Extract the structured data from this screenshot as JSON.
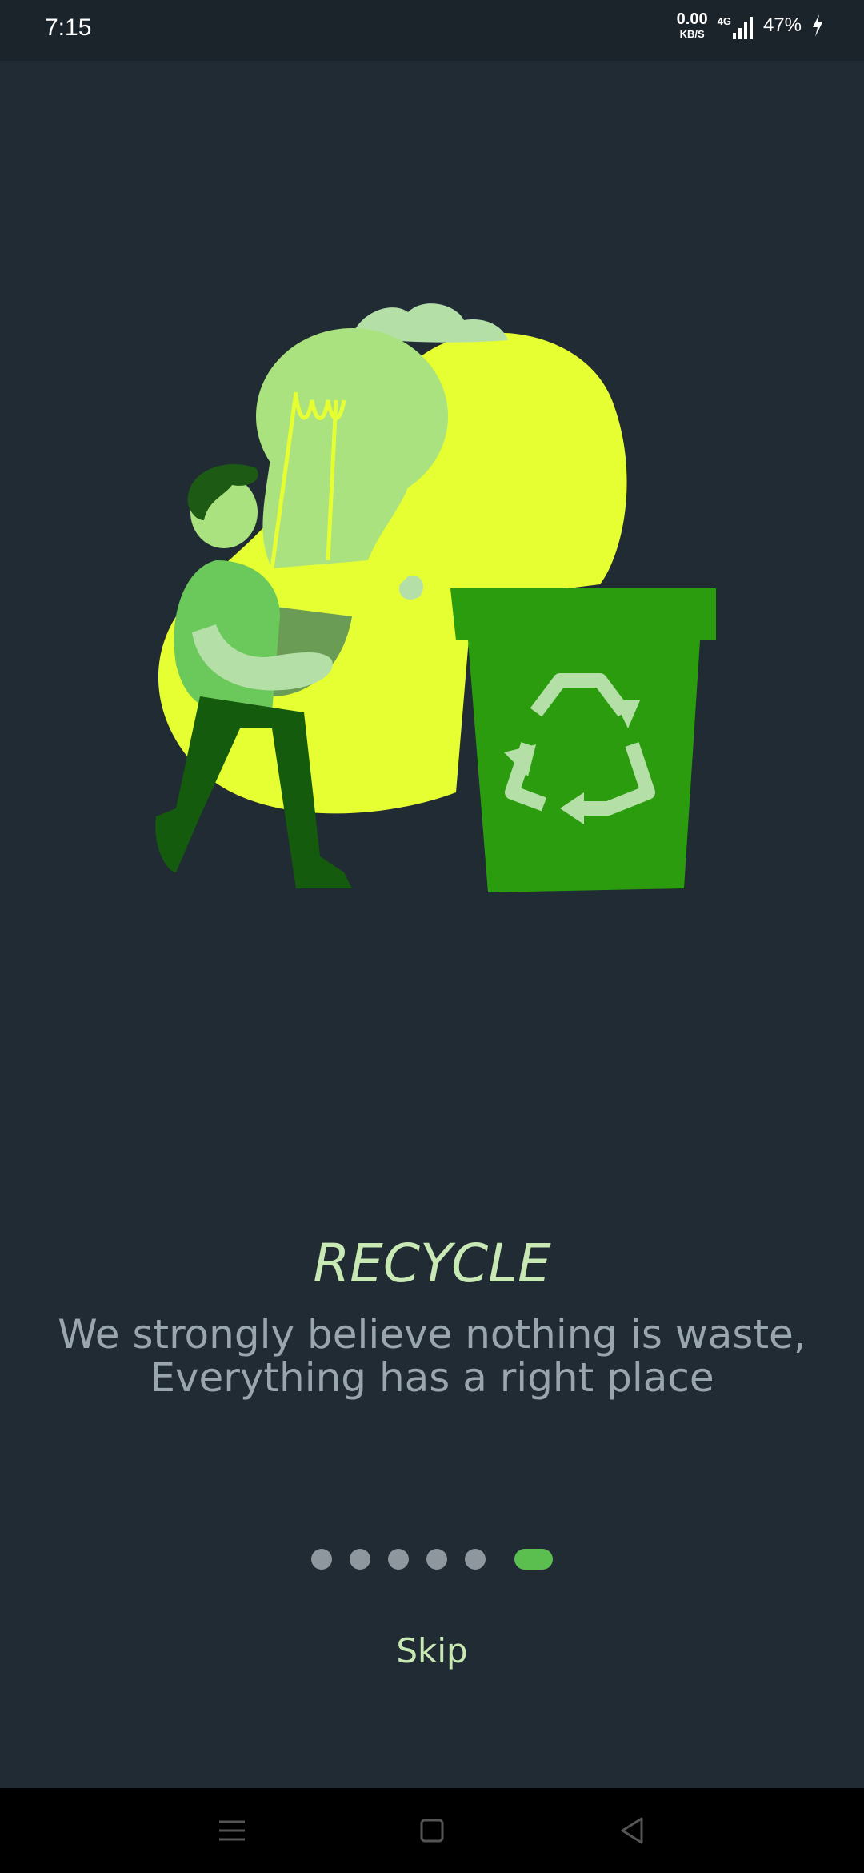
{
  "status_bar": {
    "time": "7:15",
    "net_speed_value": "0.00",
    "net_speed_unit": "KB/S",
    "network_type": "4G",
    "battery": "47%",
    "icons": [
      "signal-icon",
      "battery-charging-icon"
    ]
  },
  "onboarding": {
    "illustration": "recycle-illustration",
    "title": "RECYCLE",
    "subtitle_line1": "We strongly believe nothing is waste,",
    "subtitle_line2": "Everything has a right place",
    "page_count": 6,
    "active_page": 6,
    "skip_label": "Skip"
  },
  "colors": {
    "background": "#212b34",
    "accent": "#5bbf4f",
    "title": "#c8e8b4",
    "subtitle": "#9aa6ae",
    "dot_inactive": "#8e979d"
  },
  "nav_bar": {
    "icons": [
      "menu-icon",
      "home-icon",
      "back-icon"
    ]
  }
}
